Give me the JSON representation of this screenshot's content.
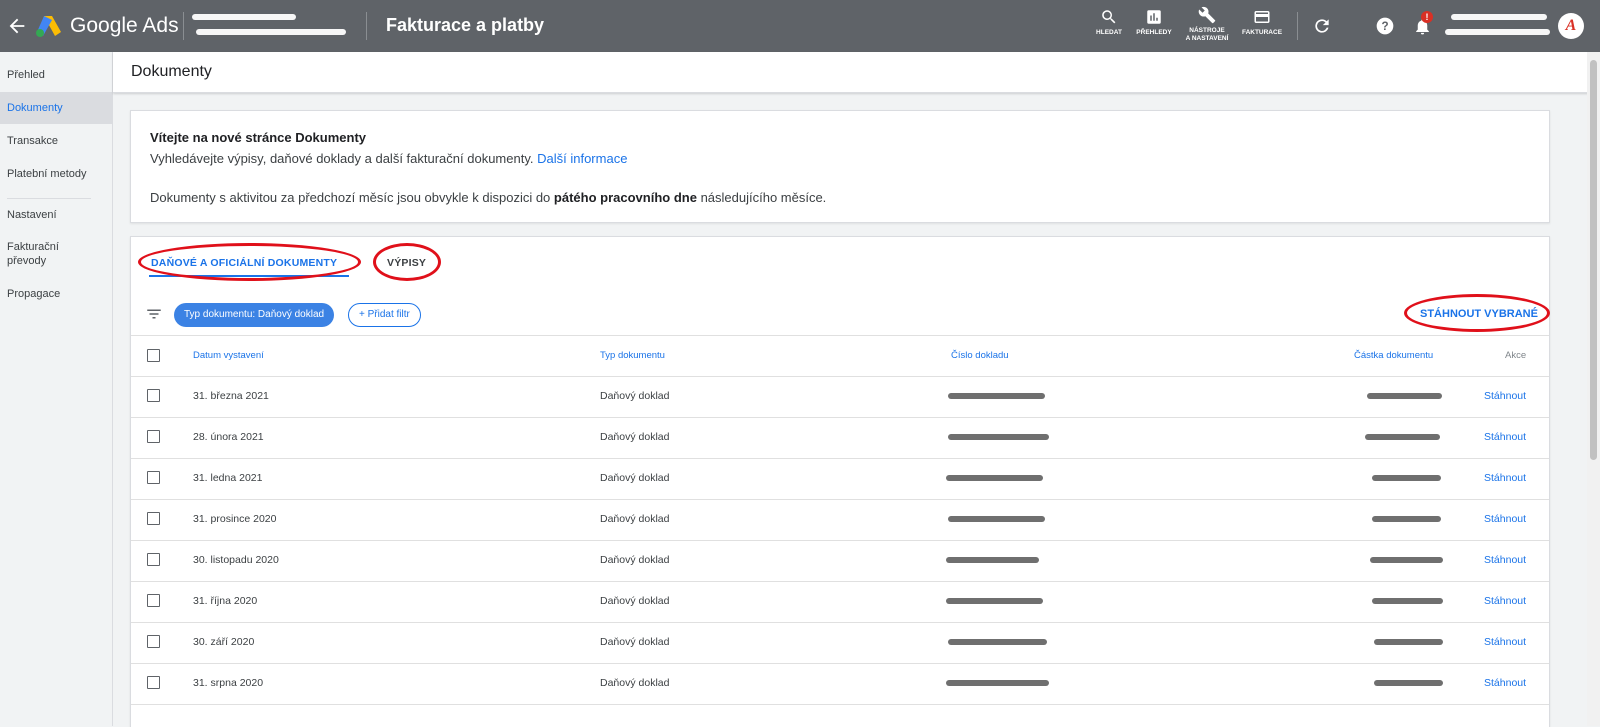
{
  "topbar": {
    "product": "Google Ads",
    "page_title": "Fakturace a platby",
    "tools": [
      {
        "label": "HLEDAT",
        "icon": "search-icon"
      },
      {
        "label": "PŘEHLEDY",
        "icon": "reports-icon"
      },
      {
        "label_line1": "NÁSTROJE",
        "label_line2": "A NASTAVENÍ",
        "icon": "wrench-icon"
      },
      {
        "label": "FAKTURACE",
        "icon": "credit-card-icon"
      }
    ],
    "notification_badge": "!",
    "avatar_letter": "A"
  },
  "sidebar": {
    "items": [
      {
        "label": "Přehled"
      },
      {
        "label": "Dokumenty",
        "active": true
      },
      {
        "label": "Transakce"
      },
      {
        "label": "Platební metody"
      },
      {
        "label": "Nastavení"
      },
      {
        "label_line1": "Fakturační",
        "label_line2": "převody"
      },
      {
        "label": "Propagace"
      }
    ]
  },
  "main": {
    "title": "Dokumenty",
    "welcome": {
      "heading": "Vítejte na nové stránce Dokumenty",
      "text": "Vyhledávejte výpisy, daňové doklady a další fakturační dokumenty.",
      "link": "Další informace",
      "note_before": "Dokumenty s aktivitou za předchozí měsíc jsou obvykle k dispozici do",
      "note_bold": "pátého pracovního dne",
      "note_after": "následujícího měsíce."
    },
    "tabs": [
      "DAŇOVÉ A OFICIÁLNÍ DOKUMENTY",
      "VÝPISY"
    ],
    "filters": {
      "active_chip": "Typ dokumentu: Daňový doklad",
      "add_filter": "+ Přidat filtr"
    },
    "download_selected": "STÁHNOUT VYBRANÉ",
    "table": {
      "columns": [
        "Datum vystavení",
        "Typ dokumentu",
        "Číslo dokladu",
        "Částka dokumentu",
        "Akce"
      ],
      "rows": [
        {
          "date": "31. března 2021",
          "type": "Daňový doklad",
          "action": "Stáhnout"
        },
        {
          "date": "28. února 2021",
          "type": "Daňový doklad",
          "action": "Stáhnout"
        },
        {
          "date": "31. ledna 2021",
          "type": "Daňový doklad",
          "action": "Stáhnout"
        },
        {
          "date": "31. prosince 2020",
          "type": "Daňový doklad",
          "action": "Stáhnout"
        },
        {
          "date": "30. listopadu 2020",
          "type": "Daňový doklad",
          "action": "Stáhnout"
        },
        {
          "date": "31. října 2020",
          "type": "Daňový doklad",
          "action": "Stáhnout"
        },
        {
          "date": "30. září 2020",
          "type": "Daňový doklad",
          "action": "Stáhnout"
        },
        {
          "date": "31. srpna 2020",
          "type": "Daňový doklad",
          "action": "Stáhnout"
        }
      ]
    }
  },
  "colors": {
    "topbar": "#5f6368",
    "accent": "#1a73e8",
    "chip": "#3b82e4",
    "annotation": "#e0101a",
    "badge": "#d93025"
  }
}
